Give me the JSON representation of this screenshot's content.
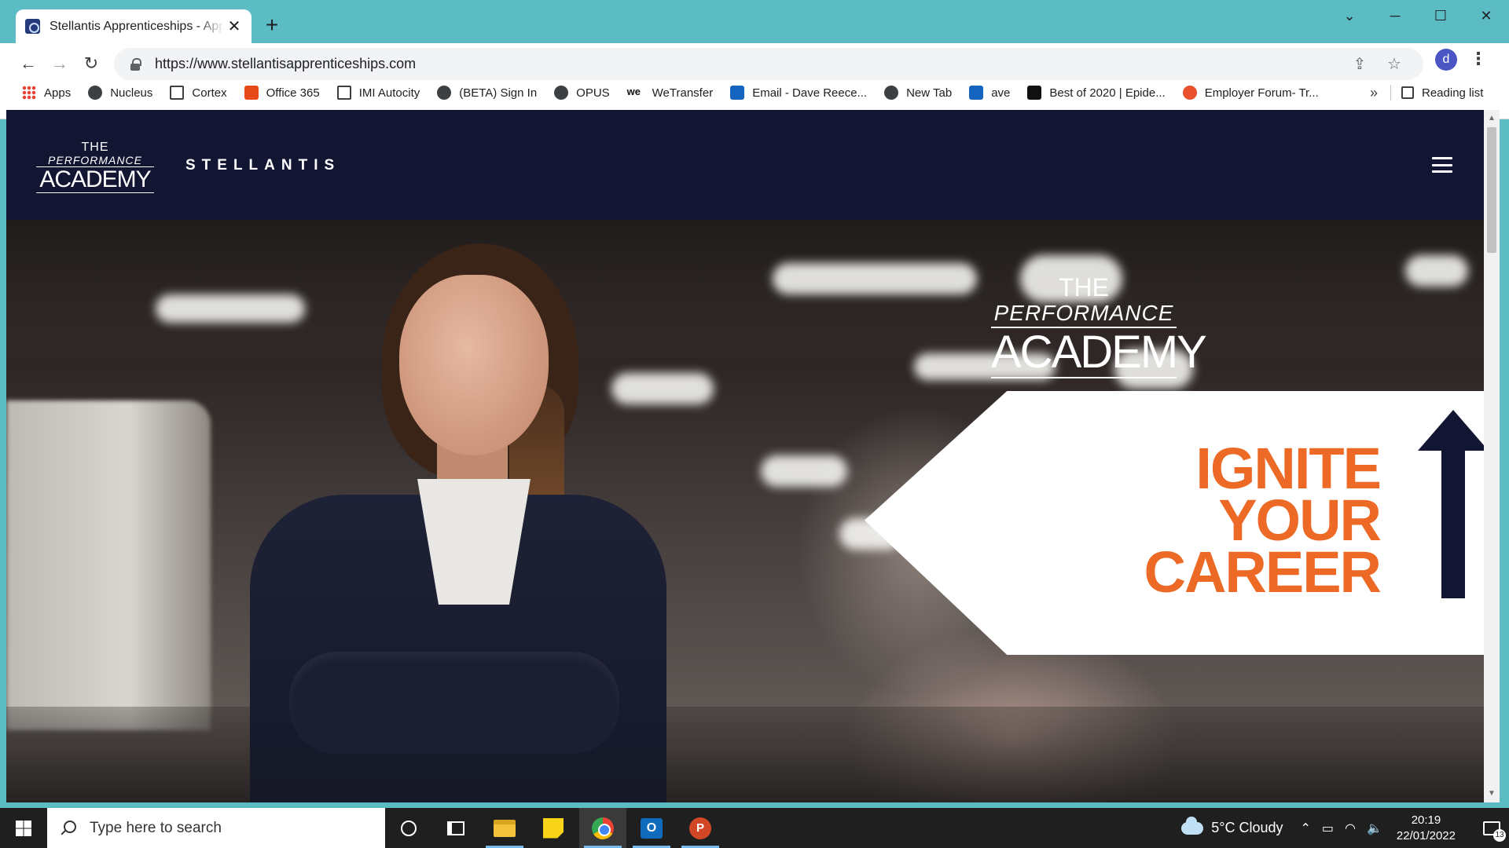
{
  "browser": {
    "tab_title": "Stellantis Apprenticeships - Apply",
    "tab_close": "✕",
    "new_tab": "+",
    "url": "https://www.stellantisapprenticeships.com",
    "profile_initial": "d",
    "window_controls": {
      "tab_search": "⌄",
      "minimize": "─",
      "maximize": "☐",
      "close": "✕"
    },
    "nav": {
      "back": "←",
      "forward": "→",
      "reload": "↻"
    },
    "omni_actions": {
      "share": "⇪",
      "bookmark": "☆"
    },
    "menu": "⋮",
    "bookmarks": [
      {
        "label": "Apps",
        "icon": "apps-grid-icon"
      },
      {
        "label": "Nucleus",
        "icon": "globe-icon"
      },
      {
        "label": "Cortex",
        "icon": "cortex-icon"
      },
      {
        "label": "Office 365",
        "icon": "office-icon"
      },
      {
        "label": "IMI Autocity",
        "icon": "imi-icon"
      },
      {
        "label": "(BETA) Sign In",
        "icon": "globe-icon"
      },
      {
        "label": "OPUS",
        "icon": "globe-icon"
      },
      {
        "label": "WeTransfer",
        "icon": "wetransfer-icon"
      },
      {
        "label": "Email - Dave Reece...",
        "icon": "outlook-icon"
      },
      {
        "label": "New Tab",
        "icon": "globe-icon"
      },
      {
        "label": "ave",
        "icon": "outlook-icon"
      },
      {
        "label": "Best of 2020 | Epide...",
        "icon": "epic-icon"
      },
      {
        "label": "Employer Forum- Tr...",
        "icon": "employer-icon"
      }
    ],
    "bookmarks_more": "»",
    "reading_list": "Reading list"
  },
  "site": {
    "header_logo": {
      "the": "THE",
      "performance": "PERFORMANCE",
      "academy": "ACADEMY"
    },
    "brand": "STELLANTIS",
    "hero_logo": {
      "the": "THE",
      "performance": "PERFORMANCE",
      "academy": "ACADEMY"
    },
    "hero_tagline": [
      "IGNITE",
      "YOUR",
      "CAREER"
    ],
    "colors": {
      "navy": "#121632",
      "orange": "#ec6a26"
    }
  },
  "taskbar": {
    "search_placeholder": "Type here to search",
    "weather": "5°C  Cloudy",
    "time": "20:19",
    "date": "22/01/2022",
    "notifications": "13",
    "apps": [
      "cortana-icon",
      "task-view-icon",
      "file-explorer-icon",
      "sticky-notes-icon",
      "chrome-icon",
      "outlook-icon",
      "powerpoint-icon"
    ],
    "tray": {
      "chevron": "⌃",
      "battery": "▭",
      "wifi": "◠",
      "volume": "🔈"
    },
    "outlook_letter": "O",
    "powerpoint_letter": "P"
  }
}
